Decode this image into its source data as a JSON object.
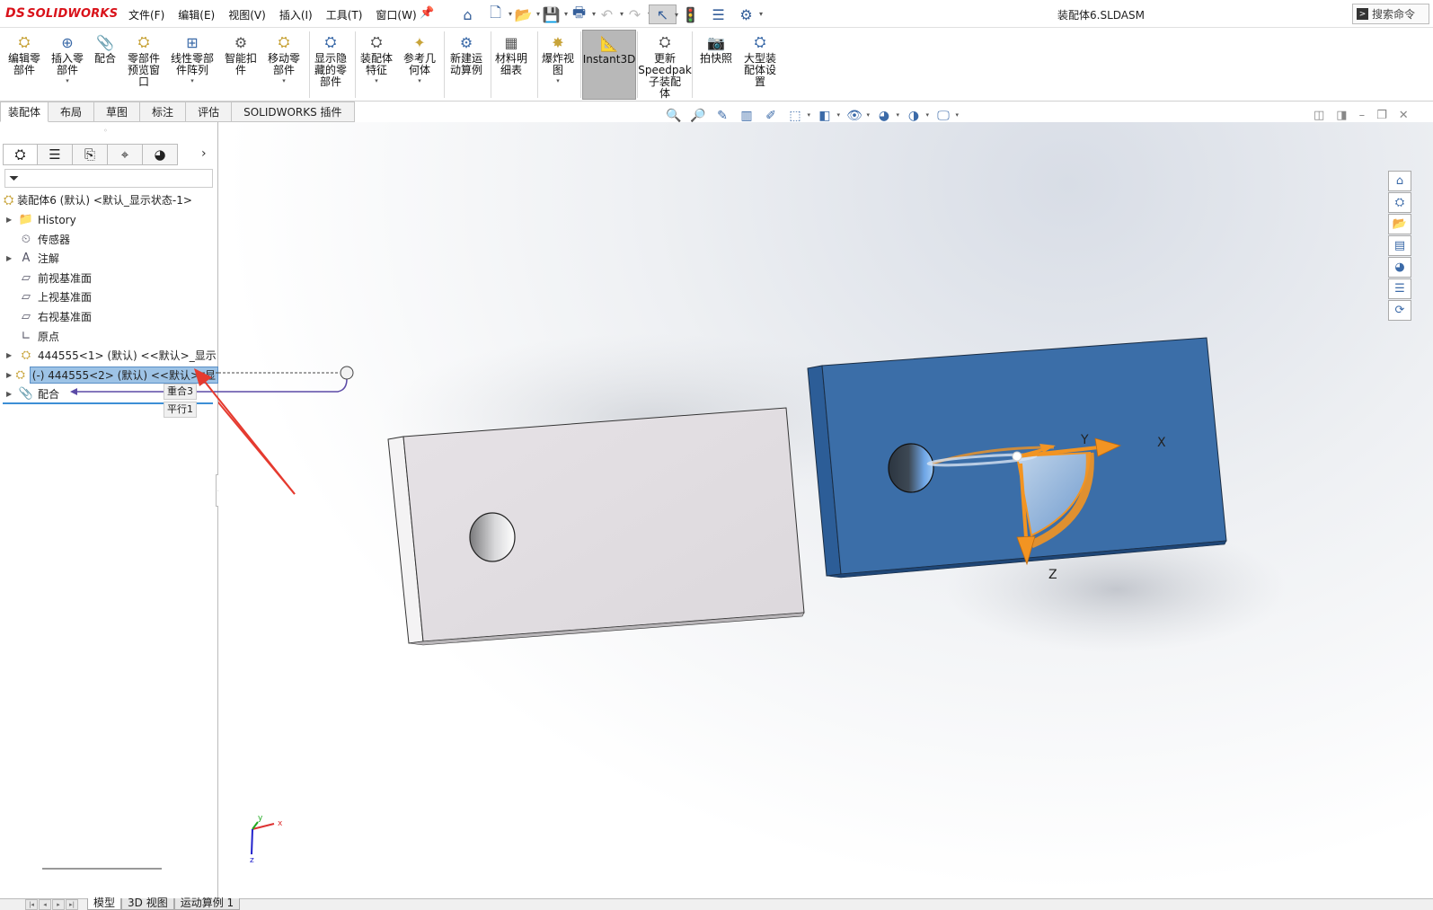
{
  "app": {
    "logo_prefix": "DS",
    "logo_text": "SOLIDWORKS",
    "document_title": "装配体6.SLDASM",
    "search_label": "搜索命令"
  },
  "menu": [
    "文件(F)",
    "编辑(E)",
    "视图(V)",
    "插入(I)",
    "工具(T)",
    "窗口(W)"
  ],
  "quick_access": [
    {
      "name": "home-icon",
      "glyph": "⌂"
    },
    {
      "name": "new-document-icon",
      "glyph": "🗋"
    },
    {
      "name": "open-folder-icon",
      "glyph": "📂"
    },
    {
      "name": "save-icon",
      "glyph": "💾"
    },
    {
      "name": "print-icon",
      "glyph": "🖶"
    },
    {
      "name": "undo-icon",
      "glyph": "↶"
    },
    {
      "name": "redo-icon",
      "glyph": "↷"
    },
    {
      "name": "select-cursor-icon",
      "glyph": "↖"
    },
    {
      "name": "traffic-light-icon",
      "glyph": "🚦"
    },
    {
      "name": "file-properties-icon",
      "glyph": "☰"
    },
    {
      "name": "options-gear-icon",
      "glyph": "⚙"
    }
  ],
  "ribbon": [
    {
      "name": "edit-component",
      "label": [
        "编辑零",
        "部件"
      ],
      "glyph": "⛭",
      "dropdown": false
    },
    {
      "name": "insert-component",
      "label": [
        "插入零",
        "部件"
      ],
      "glyph": "⊕",
      "dropdown": true
    },
    {
      "name": "mate",
      "label": [
        "配合"
      ],
      "glyph": "📎",
      "dropdown": false
    },
    {
      "name": "component-preview",
      "label": [
        "零部件",
        "预览窗",
        "口"
      ],
      "glyph": "⛭",
      "dropdown": false
    },
    {
      "name": "linear-pattern",
      "label": [
        "线性零部",
        "件阵列"
      ],
      "glyph": "⊞",
      "dropdown": true
    },
    {
      "name": "smart-fasteners",
      "label": [
        "智能扣",
        "件"
      ],
      "glyph": "⚙",
      "dropdown": false
    },
    {
      "name": "move-component",
      "label": [
        "移动零",
        "部件"
      ],
      "glyph": "⛭",
      "dropdown": true
    },
    {
      "name": "show-hidden",
      "label": [
        "显示隐",
        "藏的零",
        "部件"
      ],
      "glyph": "⛭",
      "dropdown": false
    },
    {
      "name": "assembly-features",
      "label": [
        "装配体",
        "特征"
      ],
      "glyph": "⛭",
      "dropdown": true
    },
    {
      "name": "reference-geometry",
      "label": [
        "参考几",
        "何体"
      ],
      "glyph": "✦",
      "dropdown": true
    },
    {
      "name": "new-motion-study",
      "label": [
        "新建运",
        "动算例"
      ],
      "glyph": "⚙",
      "dropdown": false
    },
    {
      "name": "bill-of-materials",
      "label": [
        "材料明",
        "细表"
      ],
      "glyph": "▦",
      "dropdown": false
    },
    {
      "name": "exploded-view",
      "label": [
        "爆炸视",
        "图"
      ],
      "glyph": "✸",
      "dropdown": true
    },
    {
      "name": "instant3d",
      "label": [
        "Instant3D"
      ],
      "glyph": "📐",
      "dropdown": false
    },
    {
      "name": "update-speedpak",
      "label": [
        "更新",
        "Speedpak",
        "子装配",
        "体"
      ],
      "glyph": "⛭",
      "dropdown": false
    },
    {
      "name": "take-snapshot",
      "label": [
        "拍快照"
      ],
      "glyph": "📷",
      "dropdown": false
    },
    {
      "name": "large-assembly-settings",
      "label": [
        "大型装",
        "配体设",
        "置"
      ],
      "glyph": "⛭",
      "dropdown": false
    }
  ],
  "tabs": [
    "装配体",
    "布局",
    "草图",
    "标注",
    "评估",
    "SOLIDWORKS 插件"
  ],
  "hud_icons": [
    {
      "name": "zoom-to-fit-icon",
      "glyph": "🔍"
    },
    {
      "name": "zoom-to-area-icon",
      "glyph": "🔎"
    },
    {
      "name": "previous-view-icon",
      "glyph": "✎"
    },
    {
      "name": "section-view-icon",
      "glyph": "▥"
    },
    {
      "name": "dynamic-annotation-icon",
      "glyph": "✐"
    },
    {
      "name": "view-orientation-icon",
      "glyph": "⬚"
    },
    {
      "name": "display-style-icon",
      "glyph": "◧"
    },
    {
      "name": "hide-show-items-icon",
      "glyph": "👁"
    },
    {
      "name": "edit-appearance-icon",
      "glyph": "◕"
    },
    {
      "name": "apply-scene-icon",
      "glyph": "◑"
    },
    {
      "name": "view-settings-icon",
      "glyph": "🖵"
    }
  ],
  "tree": {
    "root": "装配体6 (默认) <默认_显示状态-1>",
    "items": [
      {
        "name": "history",
        "label": "History",
        "glyph": "📁",
        "expandable": true,
        "selected": false
      },
      {
        "name": "sensors",
        "label": "传感器",
        "glyph": "⏲",
        "expandable": false,
        "selected": false
      },
      {
        "name": "annotations",
        "label": "注解",
        "glyph": "A",
        "expandable": true,
        "selected": false
      },
      {
        "name": "front-plane",
        "label": "前视基准面",
        "glyph": "▱",
        "expandable": false,
        "selected": false
      },
      {
        "name": "top-plane",
        "label": "上视基准面",
        "glyph": "▱",
        "expandable": false,
        "selected": false
      },
      {
        "name": "right-plane",
        "label": "右视基准面",
        "glyph": "▱",
        "expandable": false,
        "selected": false
      },
      {
        "name": "origin",
        "label": "原点",
        "glyph": "∟",
        "expandable": false,
        "selected": false
      },
      {
        "name": "component-1",
        "label": "444555<1> (默认) <<默认>_显示",
        "glyph": "⛭",
        "expandable": true,
        "selected": false
      },
      {
        "name": "component-2",
        "label": "(-) 444555<2> (默认) <<默认>_显",
        "glyph": "⛭",
        "expandable": true,
        "selected": true
      },
      {
        "name": "mates",
        "label": "配合",
        "glyph": "📎",
        "expandable": true,
        "selected": false
      }
    ],
    "mate_tips": [
      "重合3",
      "平行1"
    ]
  },
  "axis_labels": {
    "x": "X",
    "y": "Y",
    "z": "Z"
  },
  "triad_labels": {
    "x": "x",
    "y": "y",
    "z": "z"
  },
  "bottom_tabs": [
    "模型",
    "3D 视图",
    "运动算例 1"
  ],
  "colors": {
    "blue_part": "#3b6ea8",
    "blue_part_side": "#2a5a92",
    "gray_part": "#e2dfe2",
    "accent_orange": "#f29422",
    "arrow_red": "#e53a2f",
    "mate_line": "#5b4aa6"
  }
}
